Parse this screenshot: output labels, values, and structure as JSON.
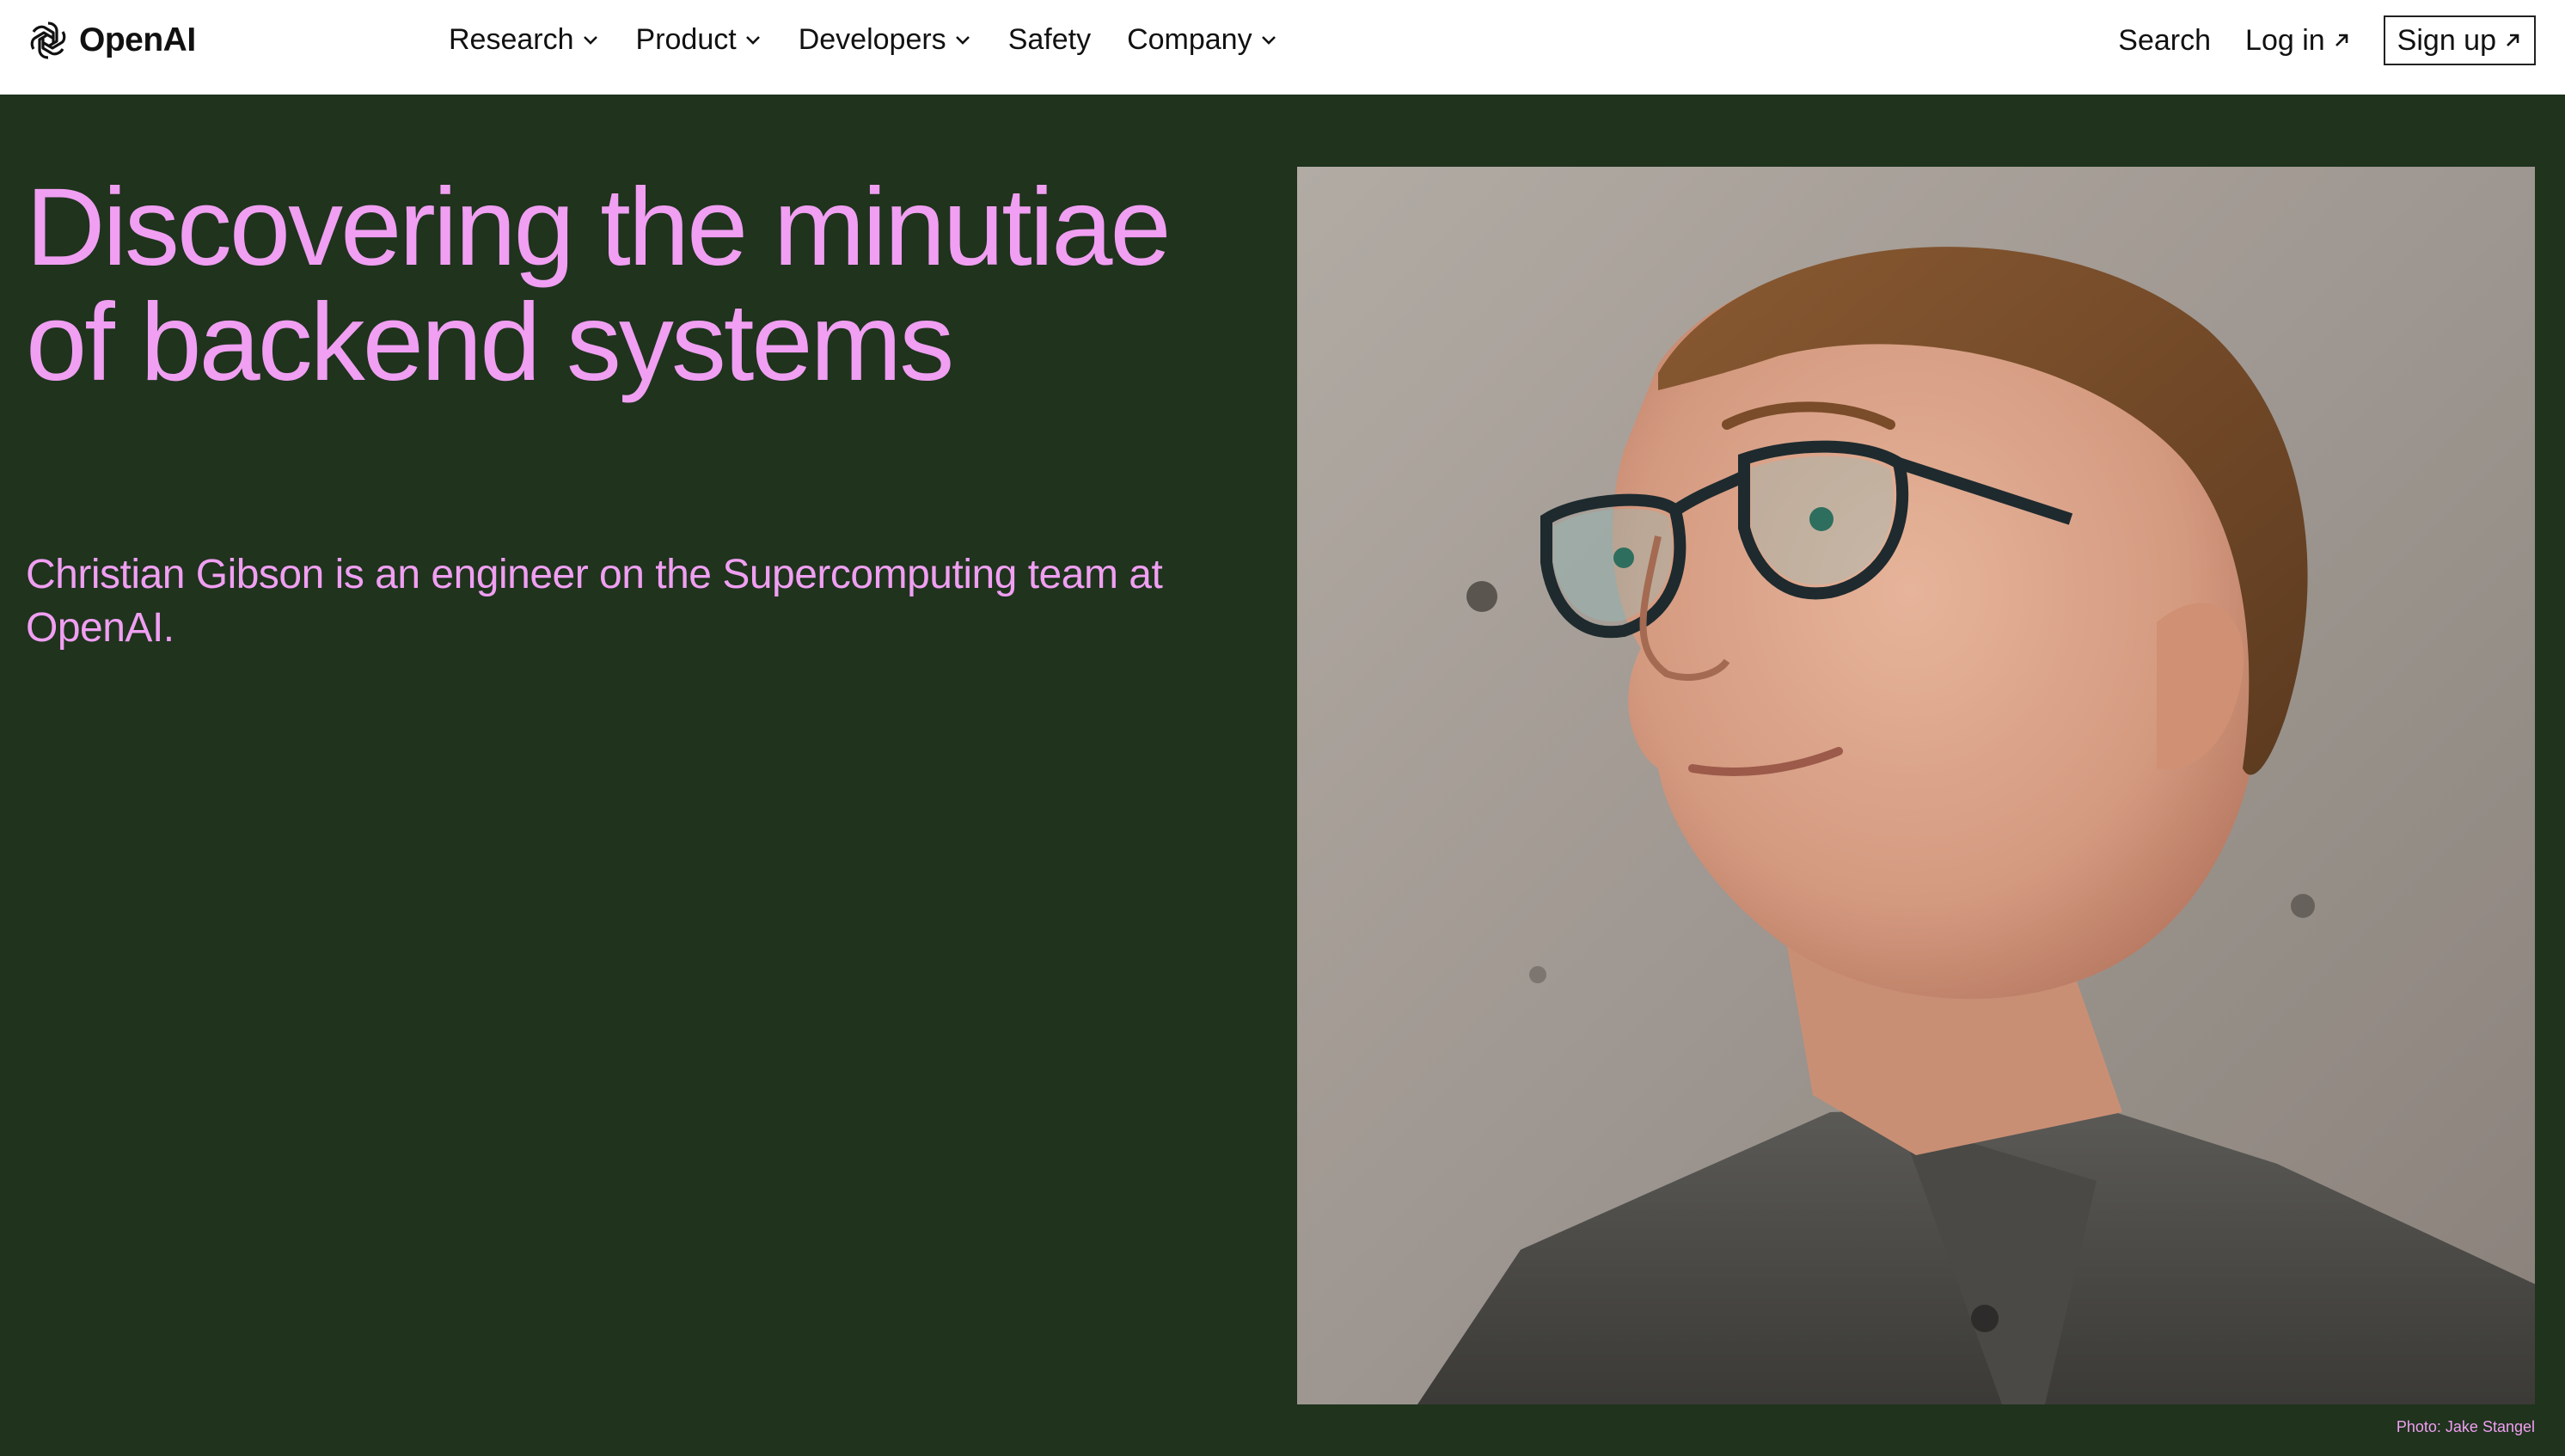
{
  "brand": {
    "name": "OpenAI",
    "logo_icon": "openai-logo-icon"
  },
  "nav": {
    "items": [
      {
        "label": "Research",
        "has_dropdown": true
      },
      {
        "label": "Product",
        "has_dropdown": true
      },
      {
        "label": "Developers",
        "has_dropdown": true
      },
      {
        "label": "Safety",
        "has_dropdown": false
      },
      {
        "label": "Company",
        "has_dropdown": true
      }
    ]
  },
  "actions": {
    "search_label": "Search",
    "login_label": "Log in",
    "signup_label": "Sign up"
  },
  "hero": {
    "title": "Discovering the minutiae of backend systems",
    "subtitle": "Christian Gibson is an engineer on the Supercomputing team at OpenAI.",
    "photo_credit": "Photo: Jake Stangel"
  },
  "colors": {
    "background": "#1f331d",
    "accent": "#f09ff2",
    "topbar": "#ffffff"
  }
}
